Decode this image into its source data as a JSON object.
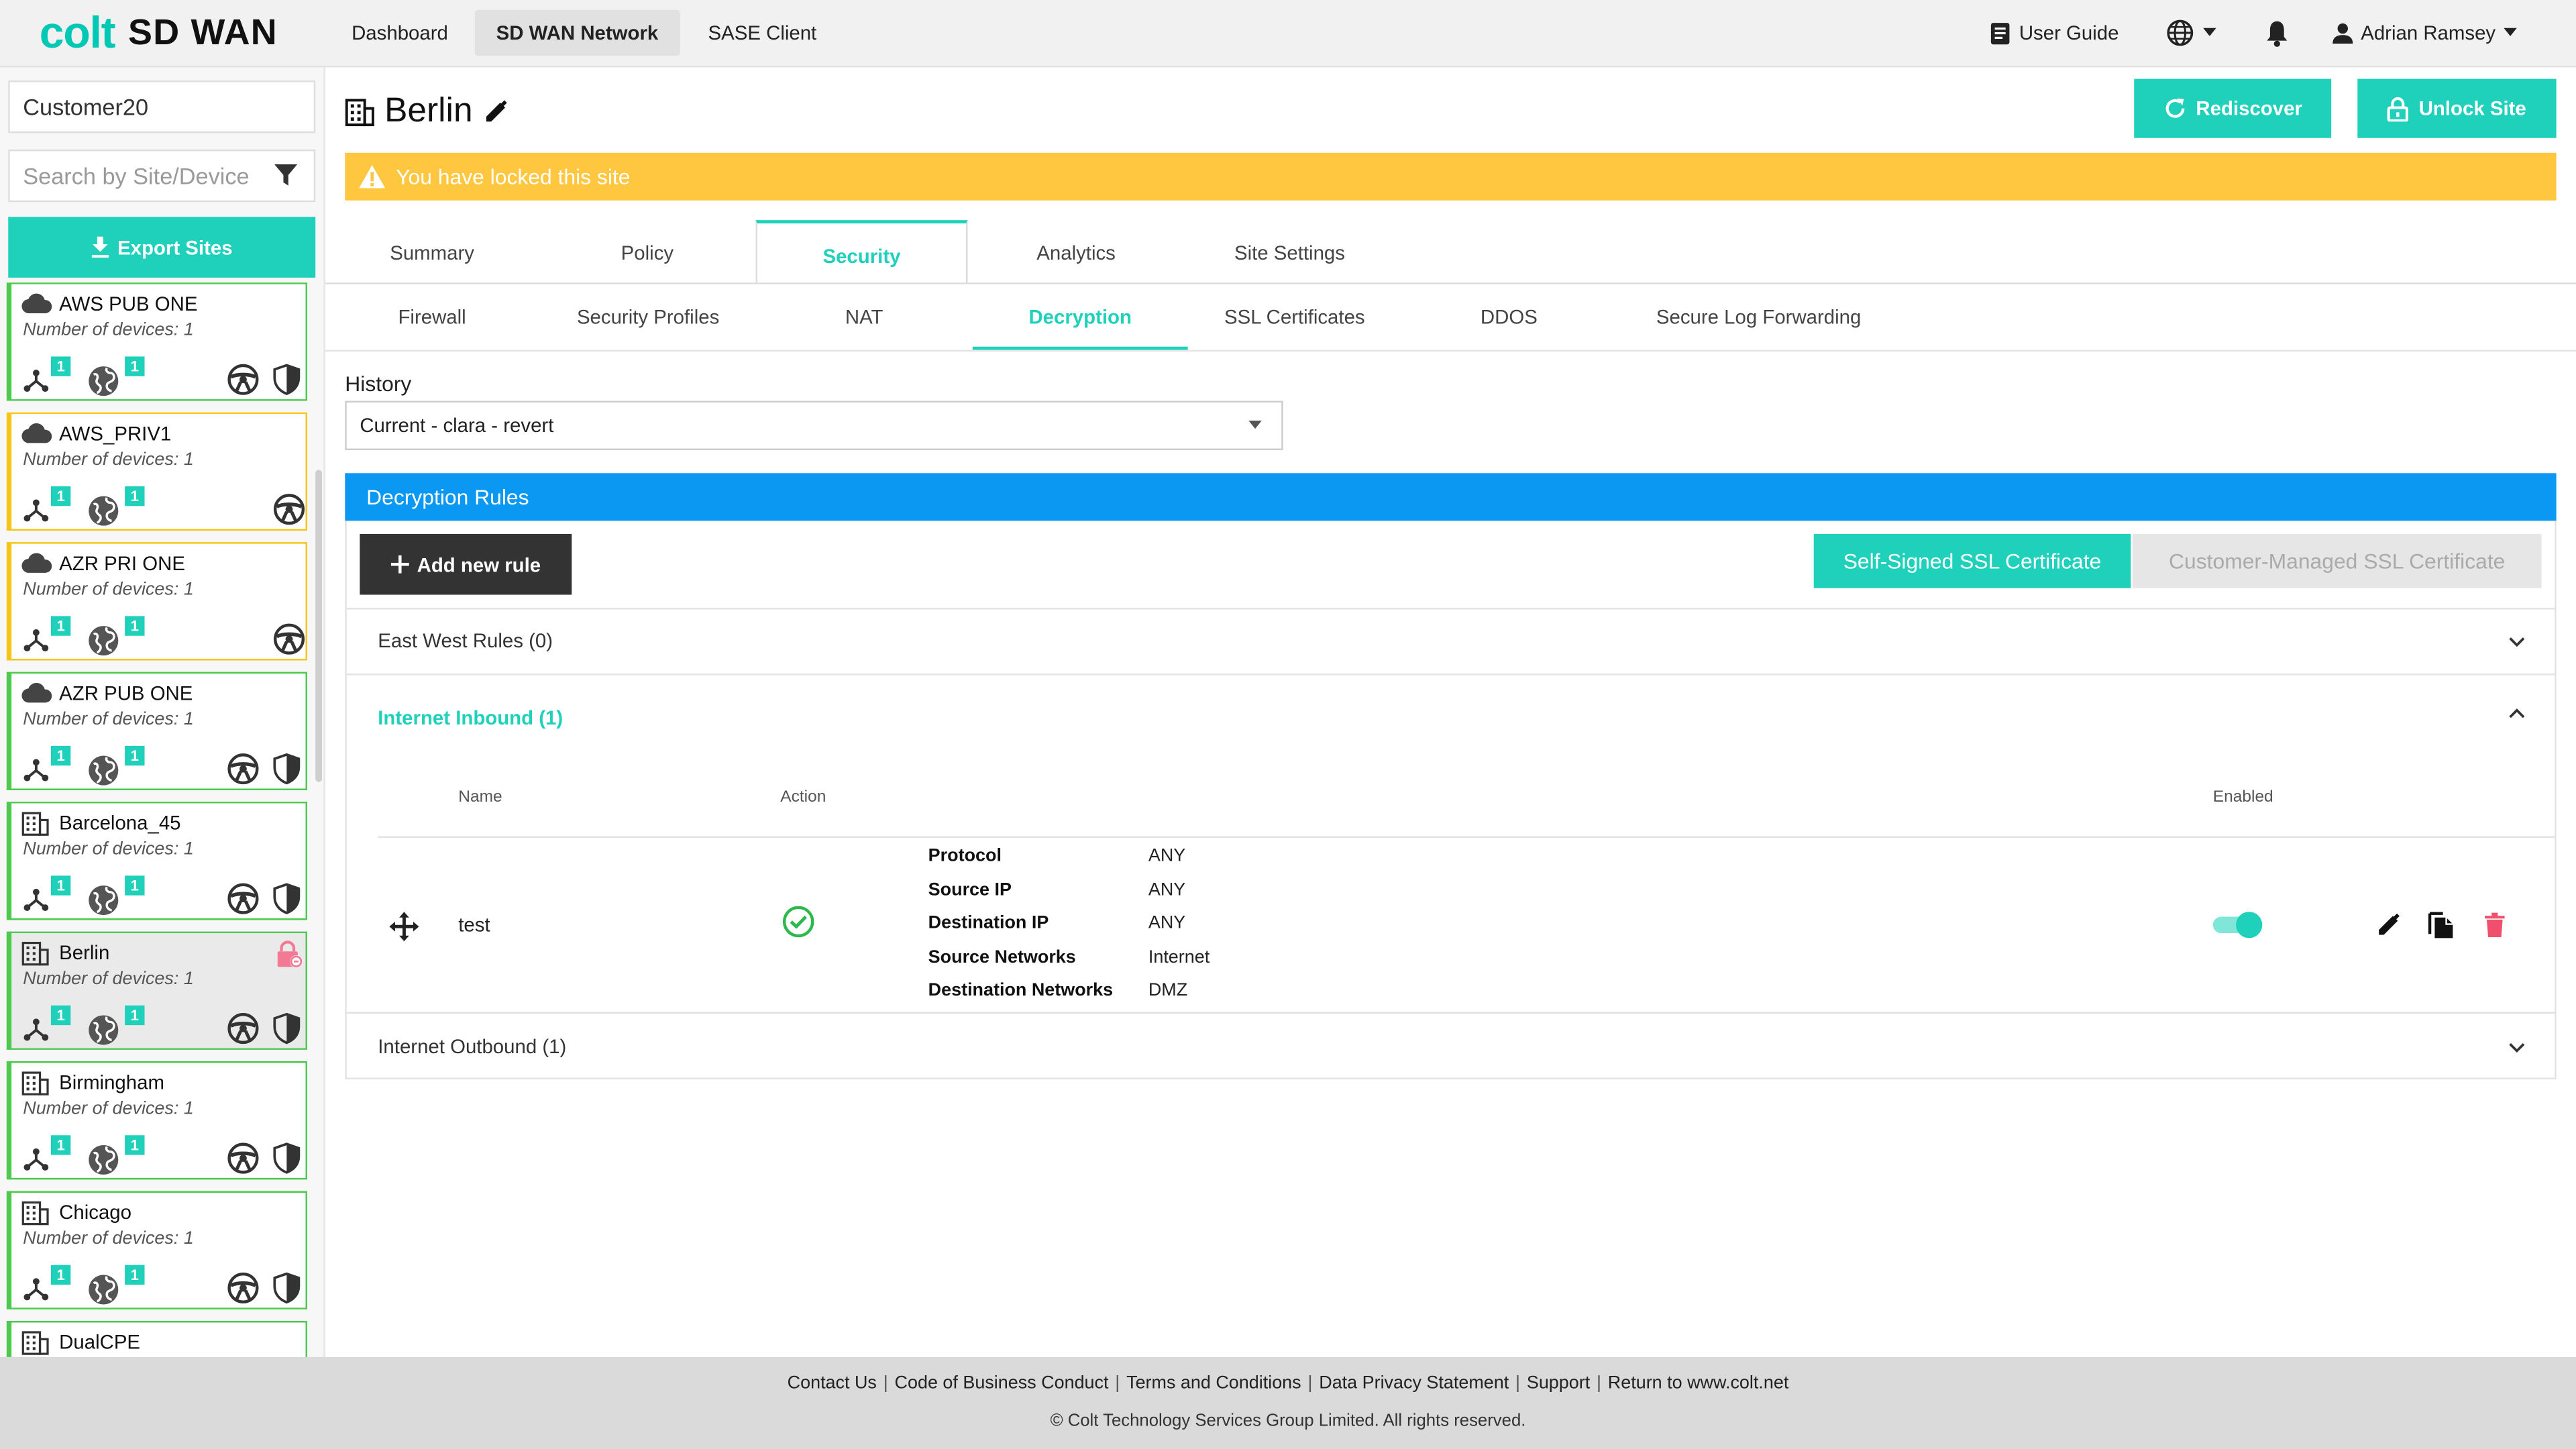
{
  "app": {
    "logo_colt": "colt",
    "logo_product": "SD WAN",
    "nav": [
      "Dashboard",
      "SD WAN Network",
      "SASE Client"
    ],
    "user_guide": "User Guide",
    "user_name": "Adrian Ramsey",
    "accent_color": "#1fd1bb"
  },
  "sidebar": {
    "customer": "Customer20",
    "search_placeholder": "Search by Site/Device",
    "export_label": "Export Sites",
    "sites": [
      {
        "name": "AWS PUB ONE",
        "devices": "Number of devices: 1",
        "type": "cloud-icon",
        "badge1": "1",
        "badge2": "1",
        "status": "green",
        "shield": true
      },
      {
        "name": "AWS_PRIV1",
        "devices": "Number of devices: 1",
        "type": "cloud-icon",
        "badge1": "1",
        "badge2": "1",
        "status": "amber",
        "shield": false
      },
      {
        "name": "AZR PRI ONE",
        "devices": "Number of devices: 1",
        "type": "cloud-icon",
        "badge1": "1",
        "badge2": "1",
        "status": "amber",
        "shield": false
      },
      {
        "name": "AZR PUB ONE",
        "devices": "Number of devices: 1",
        "type": "cloud-icon",
        "badge1": "1",
        "badge2": "1",
        "status": "green",
        "shield": true
      },
      {
        "name": "Barcelona_45",
        "devices": "Number of devices: 1",
        "type": "building-icon",
        "badge1": "1",
        "badge2": "1",
        "status": "green",
        "shield": true
      },
      {
        "name": "Berlin",
        "devices": "Number of devices: 1",
        "type": "building-icon",
        "badge1": "1",
        "badge2": "1",
        "status": "green",
        "shield": true,
        "locked": true,
        "selected": true
      },
      {
        "name": "Birmingham",
        "devices": "Number of devices: 1",
        "type": "building-icon",
        "badge1": "1",
        "badge2": "1",
        "status": "green",
        "shield": true
      },
      {
        "name": "Chicago",
        "devices": "Number of devices: 1",
        "type": "building-icon",
        "badge1": "1",
        "badge2": "1",
        "status": "green",
        "shield": true
      },
      {
        "name": "DualCPE",
        "devices": "",
        "type": "building-icon",
        "badge1": "",
        "badge2": "",
        "status": "green",
        "shield": false
      }
    ]
  },
  "page": {
    "title": "Berlin",
    "rediscover_label": "Rediscover",
    "unlock_label": "Unlock Site",
    "lock_banner": "You have locked this site",
    "tabs": [
      "Summary",
      "Policy",
      "Security",
      "Analytics",
      "Site Settings"
    ],
    "active_tab": "Security",
    "subtabs": [
      "Firewall",
      "Security Profiles",
      "NAT",
      "Decryption",
      "SSL Certificates",
      "DDOS",
      "Secure Log Forwarding"
    ],
    "active_subtab": "Decryption"
  },
  "history": {
    "label": "History",
    "selected": "Current - clara - revert"
  },
  "rules": {
    "header": "Decryption Rules",
    "add_label": "Add new rule",
    "cert_self": "Self-Signed SSL Certificate",
    "cert_customer": "Customer-Managed SSL Certificate",
    "sections": {
      "east_west": "East West Rules (0)",
      "inbound": "Internet Inbound (1)",
      "outbound": "Internet Outbound (1)"
    },
    "columns": {
      "name": "Name",
      "action": "Action",
      "enabled": "Enabled"
    },
    "row": {
      "name": "test",
      "enabled": true,
      "conditions": [
        {
          "key": "Protocol",
          "value": "ANY"
        },
        {
          "key": "Source IP",
          "value": "ANY"
        },
        {
          "key": "Destination IP",
          "value": "ANY"
        },
        {
          "key": "Source Networks",
          "value": "Internet"
        },
        {
          "key": "Destination Networks",
          "value": "DMZ"
        }
      ]
    }
  },
  "footer": {
    "links": [
      "Contact Us",
      "Code of Business Conduct",
      "Terms and Conditions",
      "Data Privacy Statement",
      "Support",
      "Return to www.colt.net"
    ],
    "copyright": "© Colt Technology Services Group Limited. All rights reserved."
  }
}
